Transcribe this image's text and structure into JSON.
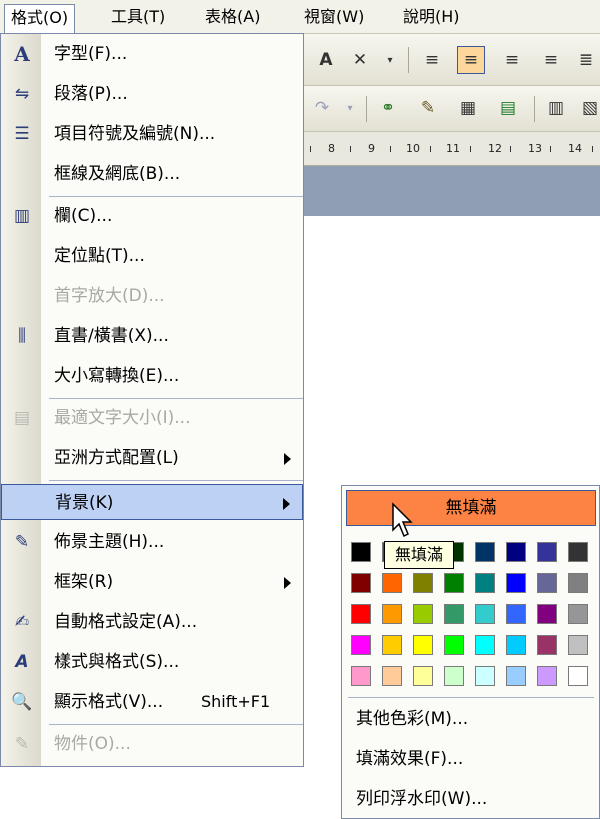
{
  "menubar": {
    "items": [
      {
        "label": "格式(O)"
      },
      {
        "label": "工具(T)"
      },
      {
        "label": "表格(A)"
      },
      {
        "label": "視窗(W)"
      },
      {
        "label": "說明(H)"
      }
    ]
  },
  "ruler": {
    "ticks": [
      "8",
      "9",
      "10",
      "11",
      "12",
      "13",
      "14"
    ]
  },
  "format_menu": {
    "items": [
      {
        "label": "字型(F)...",
        "icon": "font-a-icon",
        "enabled": true
      },
      {
        "label": "段落(P)...",
        "icon": "paragraph-icon",
        "enabled": true
      },
      {
        "label": "項目符號及編號(N)...",
        "icon": "bullets-icon",
        "enabled": true
      },
      {
        "label": "框線及網底(B)...",
        "icon": "",
        "enabled": true
      },
      {
        "label": "欄(C)...",
        "icon": "columns-icon",
        "enabled": true
      },
      {
        "label": "定位點(T)...",
        "icon": "",
        "enabled": true
      },
      {
        "label": "首字放大(D)...",
        "icon": "",
        "enabled": false
      },
      {
        "label": "直書/橫書(X)...",
        "icon": "text-direction-icon",
        "enabled": true
      },
      {
        "label": "大小寫轉換(E)...",
        "icon": "",
        "enabled": true
      },
      {
        "label": "最適文字大小(I)...",
        "icon": "fit-text-icon",
        "enabled": false
      },
      {
        "label": "亞洲方式配置(L)",
        "icon": "",
        "enabled": true,
        "submenu": true
      },
      {
        "label": "背景(K)",
        "icon": "",
        "enabled": true,
        "submenu": true,
        "highlighted": true
      },
      {
        "label": "佈景主題(H)...",
        "icon": "theme-icon",
        "enabled": true
      },
      {
        "label": "框架(R)",
        "icon": "",
        "enabled": true,
        "submenu": true
      },
      {
        "label": "自動格式設定(A)...",
        "icon": "autoformat-icon",
        "enabled": true
      },
      {
        "label": "樣式與格式(S)...",
        "icon": "styles-icon",
        "enabled": true
      },
      {
        "label": "顯示格式(V)...",
        "icon": "reveal-format-icon",
        "enabled": true,
        "shortcut": "Shift+F1"
      },
      {
        "label": "物件(O)...",
        "icon": "object-icon",
        "enabled": false
      }
    ]
  },
  "background_submenu": {
    "no_fill": "無填滿",
    "tooltip": "無填滿",
    "colors": [
      [
        "#000000",
        "#993300",
        "#333300",
        "#003300",
        "#003366",
        "#000080",
        "#333399",
        "#333333"
      ],
      [
        "#800000",
        "#FF6600",
        "#808000",
        "#008000",
        "#008080",
        "#0000FF",
        "#666699",
        "#808080"
      ],
      [
        "#FF0000",
        "#FF9900",
        "#99CC00",
        "#339966",
        "#33CCCC",
        "#3366FF",
        "#800080",
        "#969696"
      ],
      [
        "#FF00FF",
        "#FFCC00",
        "#FFFF00",
        "#00FF00",
        "#00FFFF",
        "#00CCFF",
        "#993366",
        "#C0C0C0"
      ],
      [
        "#FF99CC",
        "#FFCC99",
        "#FFFF99",
        "#CCFFCC",
        "#CCFFFF",
        "#99CCFF",
        "#CC99FF",
        "#FFFFFF"
      ]
    ],
    "items": [
      {
        "label": "其他色彩(M)..."
      },
      {
        "label": "填滿效果(F)..."
      },
      {
        "label": "列印浮水印(W)..."
      }
    ]
  }
}
